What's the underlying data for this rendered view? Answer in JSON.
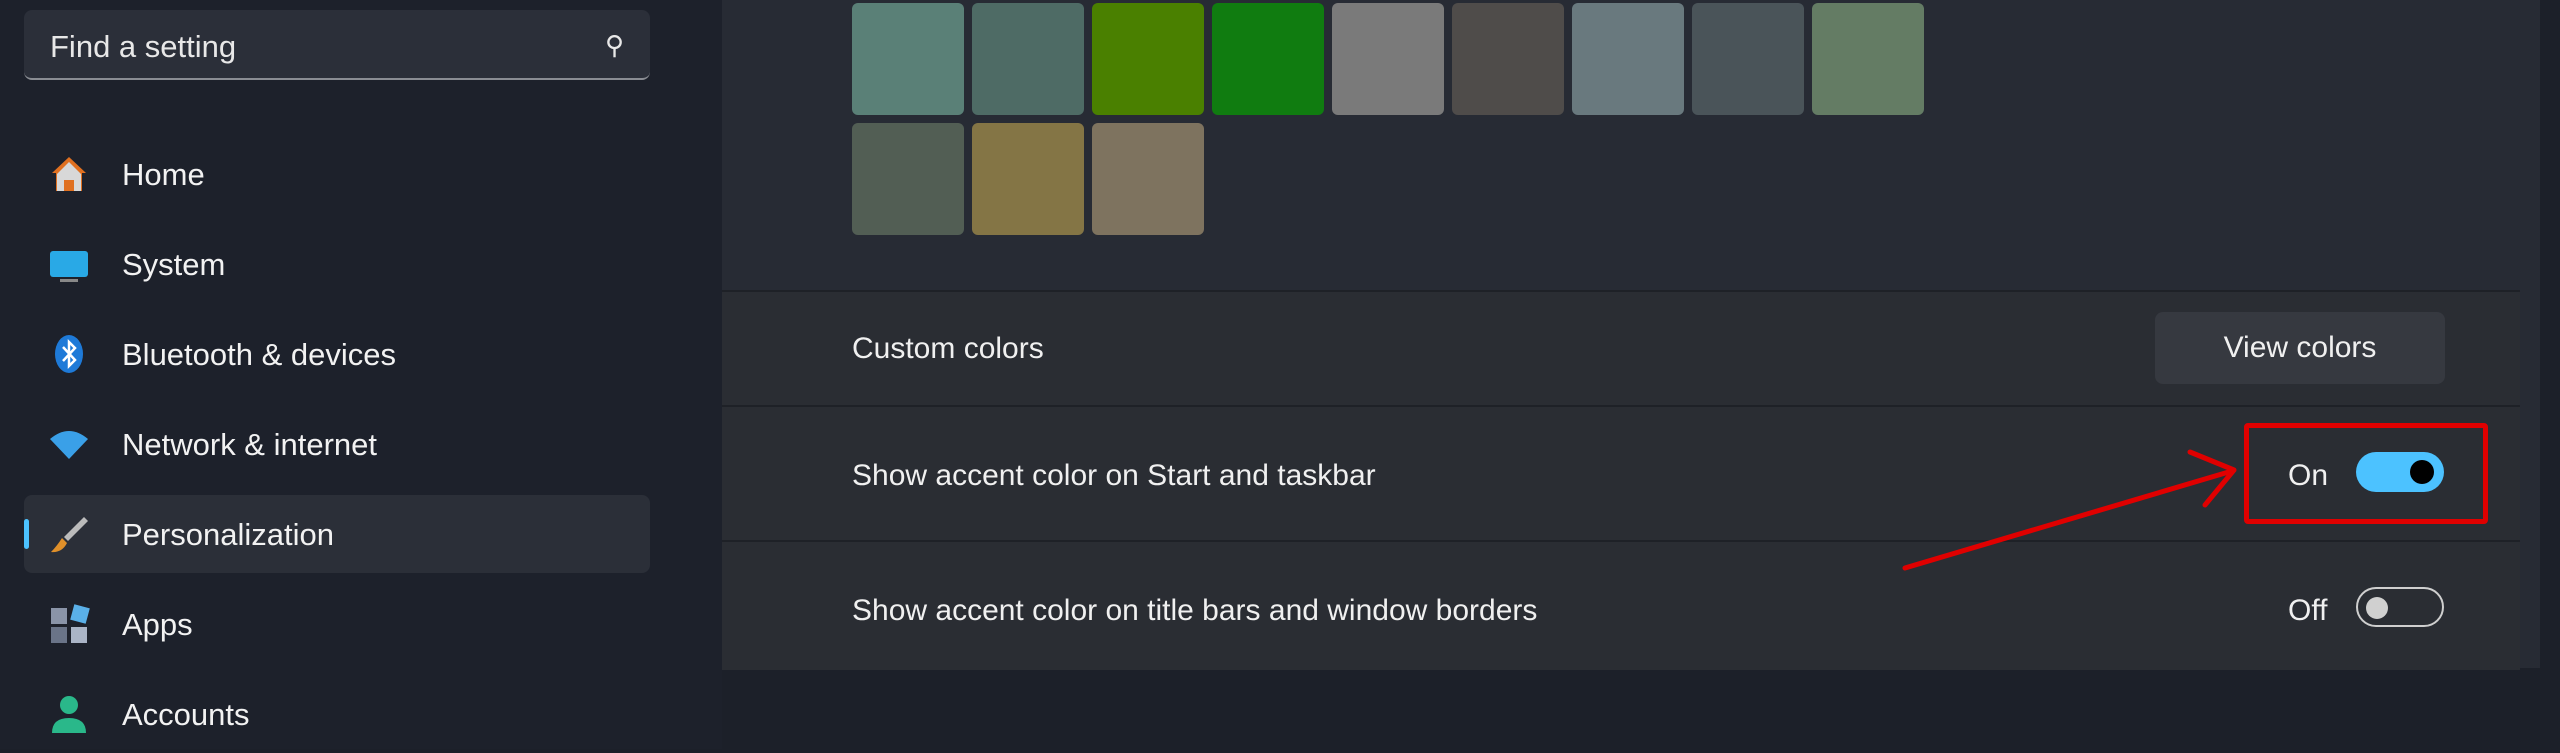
{
  "search": {
    "placeholder": "Find a setting",
    "icon": "search-icon"
  },
  "sidebar": {
    "items": [
      {
        "label": "Home",
        "icon": "home-icon"
      },
      {
        "label": "System",
        "icon": "system-icon"
      },
      {
        "label": "Bluetooth & devices",
        "icon": "bluetooth-icon"
      },
      {
        "label": "Network & internet",
        "icon": "wifi-icon"
      },
      {
        "label": "Personalization",
        "icon": "brush-icon",
        "selected": true
      },
      {
        "label": "Apps",
        "icon": "apps-icon"
      },
      {
        "label": "Accounts",
        "icon": "account-icon"
      }
    ]
  },
  "swatches": [
    [
      "#5a8077",
      "#4e6b65",
      "#4a8000",
      "#107c10",
      "#7a7a7a",
      "#4f4c4a",
      "#69797e",
      "#4a5459",
      "#647c64"
    ],
    [
      "#525e54",
      "#847545",
      "#7e735f"
    ]
  ],
  "settings": {
    "custom_colors": {
      "label": "Custom colors",
      "button": "View colors"
    },
    "accent_start": {
      "label": "Show accent color on Start and taskbar",
      "state": "On",
      "enabled": true
    },
    "accent_title": {
      "label": "Show accent color on title bars and window borders",
      "state": "Off",
      "enabled": false
    }
  },
  "colors": {
    "accent": "#4cc2ff",
    "annotation": "#e00000"
  }
}
